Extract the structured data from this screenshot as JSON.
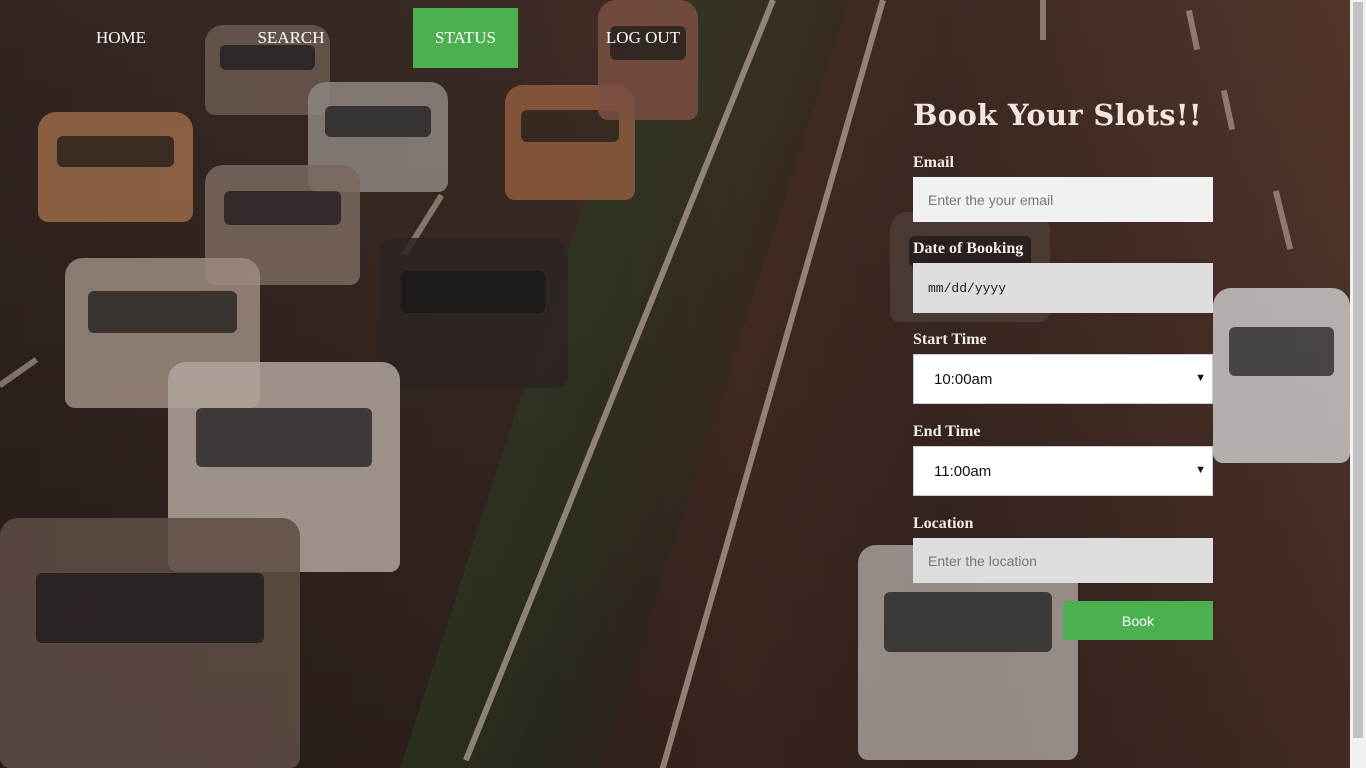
{
  "nav": {
    "items": [
      {
        "label": "HOME",
        "active": false
      },
      {
        "label": "SEARCH",
        "active": false
      },
      {
        "label": "STATUS",
        "active": true
      },
      {
        "label": "LOG OUT",
        "active": false
      }
    ]
  },
  "form": {
    "title": "Book Your Slots!!",
    "email": {
      "label": "Email",
      "placeholder": "Enter the your email",
      "value": ""
    },
    "date": {
      "label": "Date of Booking",
      "placeholder": "mm/dd/yyyy"
    },
    "start_time": {
      "label": "Start Time",
      "value": "10:00am"
    },
    "end_time": {
      "label": "End Time",
      "value": "11:00am"
    },
    "location": {
      "label": "Location",
      "placeholder": "Enter the location",
      "value": ""
    },
    "submit_label": "Book"
  },
  "colors": {
    "accent": "#4caf50",
    "input_light": "#f1f1f1",
    "input_grey": "#dddddd"
  },
  "icons": {
    "select_arrow": "caret-down-icon"
  }
}
